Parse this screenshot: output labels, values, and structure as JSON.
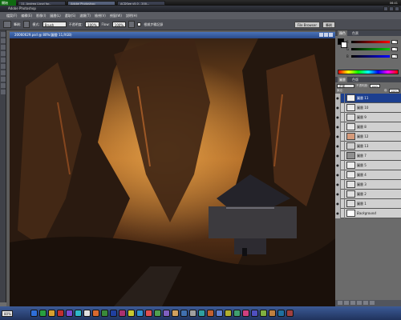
{
  "taskbar": {
    "start_label": "開始",
    "tasks": [
      "",
      "",
      "11. Andrea Lloyd for..",
      "Adobe Photoshop",
      "",
      "ACDSee v5.0 - 200..."
    ],
    "clock": "06:41"
  },
  "app": {
    "title": "Adobe Photoshop"
  },
  "menu": [
    "檔案(F)",
    "編輯(E)",
    "影像(I)",
    "圖層(L)",
    "選取(S)",
    "濾鏡(T)",
    "檢視(V)",
    "視窗(W)",
    "說明(H)"
  ],
  "options_bar": {
    "brush_label": "筆刷:",
    "mode_label": "模式:",
    "mode_value": "Brush",
    "opacity_label": "不透明度:",
    "opacity_value": "100%",
    "flow_label": "Flow:",
    "flow_value": "100%",
    "history_label": "根據步驟記錄",
    "tabs": [
      "File Browser",
      "筆刷"
    ]
  },
  "document": {
    "title": "20060629.psd @ 80%(圖層 11,RGB)"
  },
  "color_panel": {
    "tabs": [
      "顏色",
      "色票"
    ],
    "channels": [
      {
        "ch": "R",
        "value": "0",
        "color": "#c83030"
      },
      {
        "ch": "G",
        "value": "0",
        "color": "#2a9a2a"
      },
      {
        "ch": "B",
        "value": "0",
        "color": "#2a40b0"
      }
    ]
  },
  "layers_panel": {
    "tabs": [
      "圖層",
      "色版"
    ],
    "blend_mode": "正常",
    "opacity_label": "不透明度:",
    "opacity_value": "100%",
    "lock_label": "鎖定:",
    "fill_label": "填:",
    "fill_value": "100%",
    "layers": [
      {
        "name": "圖層 11",
        "thumb": "#f2f2f2",
        "selected": true
      },
      {
        "name": "圖層 10",
        "thumb": "#e9e9e9",
        "selected": false
      },
      {
        "name": "圖層 9",
        "thumb": "#dedede",
        "selected": false
      },
      {
        "name": "圖層 8",
        "thumb": "#e6e6e6",
        "selected": false
      },
      {
        "name": "圖層 12",
        "thumb": "#d59a7a",
        "selected": false
      },
      {
        "name": "圖層 13",
        "thumb": "#cfcfcf",
        "selected": false
      },
      {
        "name": "圖層 7",
        "thumb": "#8f8f8f",
        "selected": false
      },
      {
        "name": "圖層 5",
        "thumb": "#eeeeee",
        "selected": false
      },
      {
        "name": "圖層 4",
        "thumb": "#eaeaea",
        "selected": false
      },
      {
        "name": "圖層 3",
        "thumb": "#e4e4e4",
        "selected": false
      },
      {
        "name": "圖層 2",
        "thumb": "#e0e0e0",
        "selected": false
      },
      {
        "name": "圖層 1",
        "thumb": "#dcdcdc",
        "selected": false
      },
      {
        "name": "Background",
        "thumb": "#ffffff",
        "selected": false
      }
    ]
  },
  "status": {
    "zoom": "80%"
  }
}
